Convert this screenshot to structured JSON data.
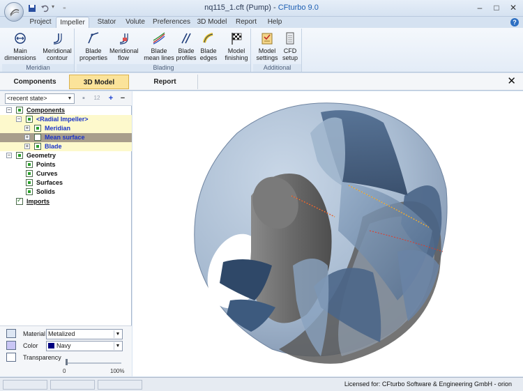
{
  "window": {
    "title_doc": "nq115_1.cft (Pump)",
    "title_sep": " - ",
    "title_app": "CFturbo 9.0",
    "minimize": "–",
    "maximize": "□",
    "close": "✕"
  },
  "ribbon": {
    "tabs": [
      "Project",
      "Impeller",
      "Stator",
      "Volute",
      "Preferences",
      "3D Model",
      "Report",
      "Help"
    ],
    "active_tab": "Impeller",
    "groups": [
      {
        "label": "Meridian",
        "buttons": [
          "Main\ndimensions",
          "Meridional\ncontour"
        ]
      },
      {
        "label": "Blading",
        "buttons": [
          "Blade\nproperties",
          "Meridional\nflow",
          "Blade\nmean lines",
          "Blade\nprofiles",
          "Blade\nedges",
          "Model\nfinishing"
        ]
      },
      {
        "label": "Additional",
        "buttons": [
          "Model\nsettings",
          "CFD\nsetup"
        ]
      }
    ]
  },
  "view_tabs": [
    "Components",
    "3D Model",
    "Report"
  ],
  "active_view_tab": "3D Model",
  "tree_panel": {
    "state_select": "<recent state>",
    "items": [
      {
        "label": "Components",
        "level": 0,
        "expander": "−"
      },
      {
        "label": "<Radial Impeller>",
        "level": 1,
        "expander": "−"
      },
      {
        "label": "Meridian",
        "level": 2,
        "expander": "+"
      },
      {
        "label": "Mean surface",
        "level": 2,
        "expander": "+"
      },
      {
        "label": "Blade",
        "level": 2,
        "expander": "+"
      },
      {
        "label": "Geometry",
        "level": 0,
        "expander": "−"
      },
      {
        "label": "Points",
        "level": 1
      },
      {
        "label": "Curves",
        "level": 1
      },
      {
        "label": "Surfaces",
        "level": 1
      },
      {
        "label": "Solids",
        "level": 1
      },
      {
        "label": "Imports",
        "level": 0
      }
    ]
  },
  "properties": {
    "material_label": "Material",
    "material_value": "Metalized",
    "color_label": "Color",
    "color_value": "Navy",
    "color_hex": "#000080",
    "transparency_label": "Transparency",
    "transparency_min": "0",
    "transparency_max": "100%",
    "transparency_value": 0
  },
  "status": {
    "license": "Licensed for: CFturbo Software & Engineering GmbH - orion"
  },
  "colors": {
    "impeller_blue": "#7b95b3",
    "hub_gray": "#6e6e6e",
    "highlight_tab": "#fbe39a",
    "selected_row": "#a89e8c"
  }
}
